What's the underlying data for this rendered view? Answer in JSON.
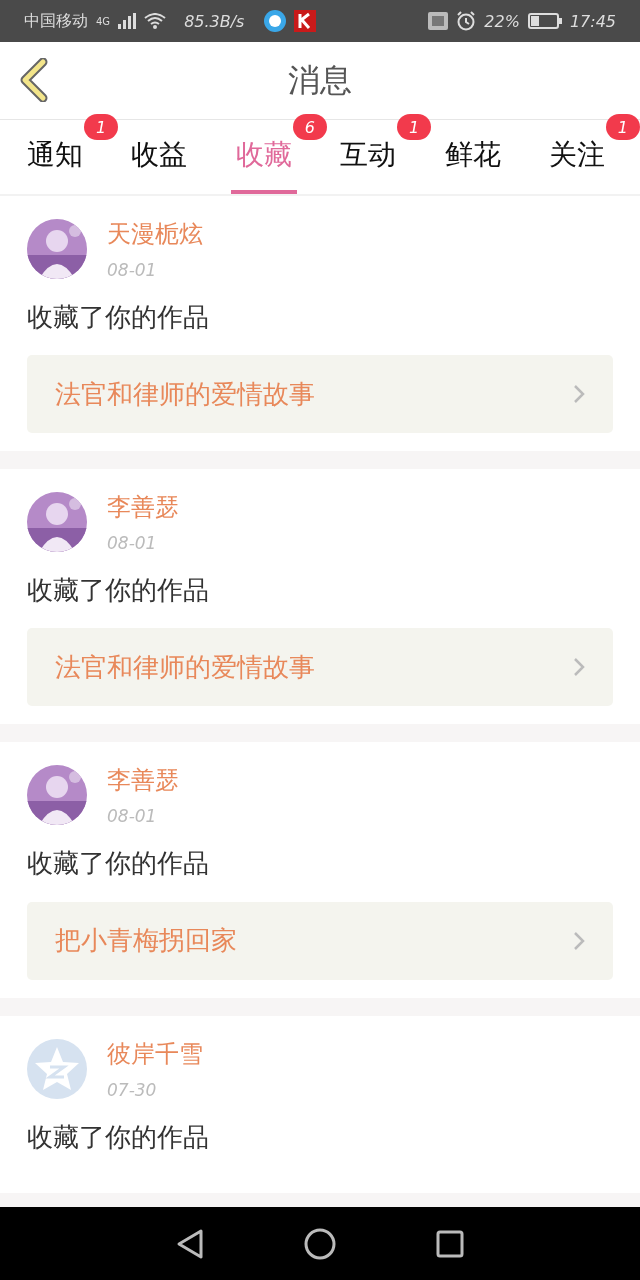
{
  "status_bar": {
    "carrier": "中国移动",
    "network": "4G",
    "speed": "85.3B/s",
    "battery_percent": "22%",
    "time": "17:45"
  },
  "header": {
    "title": "消息"
  },
  "tabs": [
    {
      "label": "通知",
      "badge": "1",
      "selected": false
    },
    {
      "label": "收益",
      "selected": false
    },
    {
      "label": "收藏",
      "badge": "6",
      "selected": true
    },
    {
      "label": "互动",
      "badge": "1",
      "selected": false
    },
    {
      "label": "鲜花",
      "selected": false
    },
    {
      "label": "关注",
      "badge": "1",
      "selected": false
    }
  ],
  "messages": [
    {
      "name": "天漫栀炫",
      "date": "08-01",
      "action": "收藏了你的作品",
      "work": "法官和律师的爱情故事"
    },
    {
      "name": "李善瑟",
      "date": "08-01",
      "action": "收藏了你的作品",
      "work": "法官和律师的爱情故事"
    },
    {
      "name": "李善瑟",
      "date": "08-01",
      "action": "收藏了你的作品",
      "work": "把小青梅拐回家"
    },
    {
      "avatar": {
        "kind": "default"
      },
      "name": "彼岸千雪",
      "date": "07-30",
      "action": "收藏了你的作品"
    }
  ]
}
